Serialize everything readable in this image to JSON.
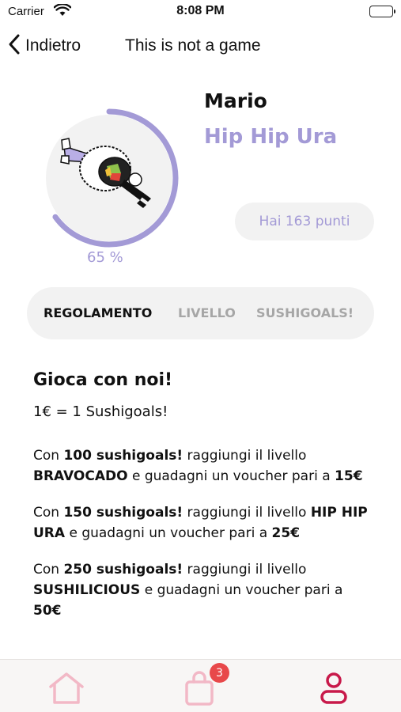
{
  "status_bar": {
    "carrier": "Carrier",
    "time": "8:08 PM"
  },
  "nav": {
    "back_label": "Indietro",
    "title": "This is not a game"
  },
  "profile": {
    "name": "Mario",
    "level": "Hip Hip Ura",
    "points_text": "Hai 163 punti",
    "progress_text": "65 %",
    "progress_fraction": 0.65
  },
  "tabs": [
    {
      "label": "REGOLAMENTO",
      "active": true
    },
    {
      "label": "LIVELLO",
      "active": false
    },
    {
      "label": "SUSHIGOALS!",
      "active": false
    }
  ],
  "rules": {
    "title": "Gioca con noi!",
    "rate": "1€ = 1 Sushigoals!",
    "items": [
      {
        "prefix": "Con ",
        "goals": "100 sushigoals!",
        "mid": " raggiungi il livello ",
        "level": "BRAVOCADO",
        "suffix": " e guadagni un voucher pari a ",
        "voucher": "15€"
      },
      {
        "prefix": "Con ",
        "goals": "150 sushigoals!",
        "mid": " raggiungi il livello ",
        "level": "HIP HIP URA",
        "suffix": " e guadagni un voucher pari a ",
        "voucher": "25€"
      },
      {
        "prefix": "Con ",
        "goals": "250 sushigoals!",
        "mid": " raggiungi il livello ",
        "level": "SUSHILICIOUS",
        "suffix": " e guadagni un voucher pari a ",
        "voucher": "50€"
      }
    ]
  },
  "tab_bar": {
    "cart_badge": "3"
  },
  "colors": {
    "accent": "#a39ad6",
    "pink": "#f2b8c6",
    "crimson": "#c8194a",
    "badge": "#e8484a"
  }
}
